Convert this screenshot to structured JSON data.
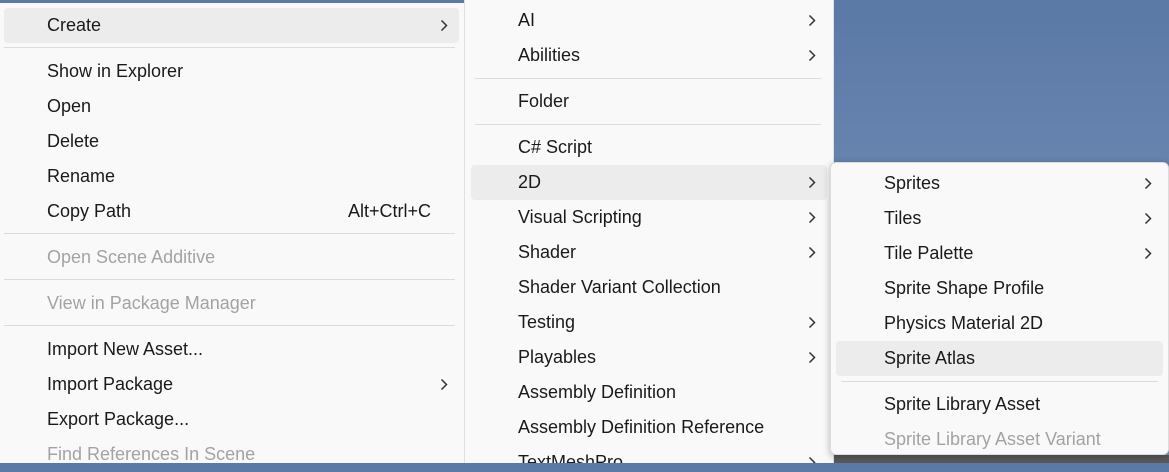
{
  "menu1": {
    "items": [
      {
        "label": "Create"
      },
      {
        "label": "Show in Explorer"
      },
      {
        "label": "Open"
      },
      {
        "label": "Delete"
      },
      {
        "label": "Rename"
      },
      {
        "label": "Copy Path",
        "shortcut": "Alt+Ctrl+C"
      },
      {
        "label": "Open Scene Additive"
      },
      {
        "label": "View in Package Manager"
      },
      {
        "label": "Import New Asset..."
      },
      {
        "label": "Import Package"
      },
      {
        "label": "Export Package..."
      },
      {
        "label": "Find References In Scene"
      }
    ]
  },
  "menu2": {
    "items": [
      {
        "label": "AI"
      },
      {
        "label": "Abilities"
      },
      {
        "label": "Folder"
      },
      {
        "label": "C# Script"
      },
      {
        "label": "2D"
      },
      {
        "label": "Visual Scripting"
      },
      {
        "label": "Shader"
      },
      {
        "label": "Shader Variant Collection"
      },
      {
        "label": "Testing"
      },
      {
        "label": "Playables"
      },
      {
        "label": "Assembly Definition"
      },
      {
        "label": "Assembly Definition Reference"
      },
      {
        "label": "TextMeshPro"
      }
    ]
  },
  "menu3": {
    "items": [
      {
        "label": "Sprites"
      },
      {
        "label": "Tiles"
      },
      {
        "label": "Tile Palette"
      },
      {
        "label": "Sprite Shape Profile"
      },
      {
        "label": "Physics Material 2D"
      },
      {
        "label": "Sprite Atlas"
      },
      {
        "label": "Sprite Library Asset"
      },
      {
        "label": "Sprite Library Asset Variant"
      }
    ]
  },
  "icons": {
    "submenu_arrow": "chevron-right-icon"
  },
  "colors": {
    "menu_bg": "#f9f9f9",
    "highlight_bg": "#ececec",
    "text": "#1a1a1a",
    "disabled_text": "#a3a3a3",
    "desktop_top": "#5b79a5",
    "desktop_bottom": "#7b98c0"
  }
}
